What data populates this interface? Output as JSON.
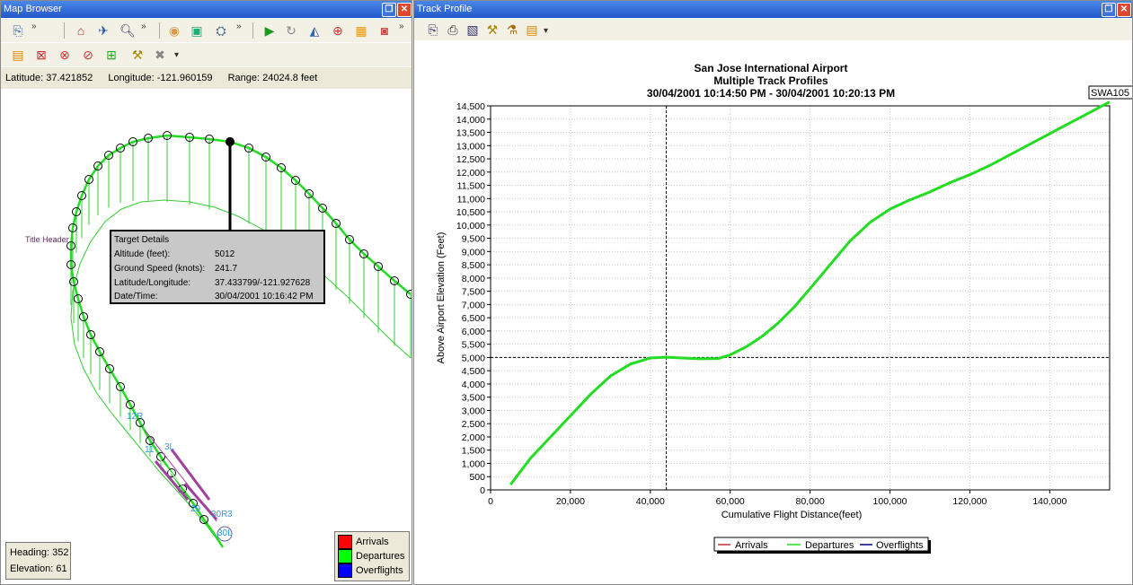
{
  "left_window": {
    "title": "Map Browser",
    "coords": {
      "latitude": "Latitude: 37.421852",
      "longitude": "Longitude: -121.960159",
      "range": "Range: 24024.8 feet"
    },
    "tooltip": {
      "heading": "Target Details",
      "rows": [
        {
          "label": "Altitude (feet):",
          "value": "5012"
        },
        {
          "label": "Ground Speed (knots):",
          "value": "241.7"
        },
        {
          "label": "Latitude/Longitude:",
          "value": "37.433799/-121.927628"
        },
        {
          "label": "Date/Time:",
          "value": "30/04/2001 10:16:42 PM"
        }
      ]
    },
    "map_labels": {
      "title_header": "Title Header",
      "runway_12r": "12R",
      "runway_11": "11",
      "runway_3l": "3L",
      "runway_29": "29",
      "runway_30r": "30R",
      "runway_3": "3",
      "runway_30l": "30L"
    },
    "status": {
      "heading": "Heading: 352",
      "elevation": "Elevation: 61"
    },
    "legend": [
      {
        "label": "Arrivals",
        "color": "#ff0000"
      },
      {
        "label": "Departures",
        "color": "#00ff00"
      },
      {
        "label": "Overflights",
        "color": "#0000ff"
      }
    ]
  },
  "right_window": {
    "title": "Track Profile",
    "track_tag": "SWA105"
  },
  "colors": {
    "track": "#22dd22",
    "curtain": "#33cc33",
    "title_bar": "#2458c9"
  },
  "chart_data": {
    "type": "line",
    "title": "San Jose International Airport",
    "subtitle": "Multiple Track Profiles",
    "time_range": "30/04/2001 10:14:50 PM - 30/04/2001 10:20:13 PM",
    "xlabel": "Cumulative Flight Distance(feet)",
    "ylabel": "Above Airport Elevation (Feet)",
    "xlim": [
      0,
      155000
    ],
    "ylim": [
      0,
      14500
    ],
    "x_ticks": [
      0,
      20000,
      40000,
      60000,
      80000,
      100000,
      120000,
      140000
    ],
    "x_tick_labels": [
      "0",
      "20,000",
      "40,000",
      "60,000",
      "80,000",
      "100,000",
      "120,000",
      "140,000"
    ],
    "y_ticks": [
      0,
      500,
      1000,
      1500,
      2000,
      2500,
      3000,
      3500,
      4000,
      4500,
      5000,
      5500,
      6000,
      6500,
      7000,
      7500,
      8000,
      8500,
      9000,
      9500,
      10000,
      10500,
      11000,
      11500,
      12000,
      12500,
      13000,
      13500,
      14000,
      14500
    ],
    "y_tick_labels": [
      "0",
      "500",
      "1,000",
      "1,500",
      "2,000",
      "2,500",
      "3,000",
      "3,500",
      "4,000",
      "4,500",
      "5,000",
      "5,500",
      "6,000",
      "6,500",
      "7,000",
      "7,500",
      "8,000",
      "8,500",
      "9,000",
      "9,500",
      "10,000",
      "10,500",
      "11,000",
      "11,500",
      "12,000",
      "12,500",
      "13,000",
      "13,500",
      "14,000",
      "14,500"
    ],
    "grid": true,
    "crosshair": {
      "x": 44000,
      "y": 5000
    },
    "legend": [
      "Arrivals",
      "Departures",
      "Overflights"
    ],
    "legend_position": "bottom",
    "series": [
      {
        "name": "Departures",
        "color": "#22dd22",
        "x": [
          5000,
          10000,
          15000,
          20000,
          25000,
          30000,
          35000,
          40000,
          44000,
          48000,
          52000,
          57000,
          60000,
          64000,
          68000,
          72000,
          76000,
          80000,
          85000,
          90000,
          95000,
          100000,
          105000,
          110000,
          115000,
          120000,
          125000,
          130000,
          135000,
          140000,
          145000,
          150000,
          155000
        ],
        "y": [
          200,
          1200,
          2000,
          2800,
          3600,
          4300,
          4750,
          4980,
          5010,
          4980,
          4950,
          4960,
          5100,
          5400,
          5800,
          6300,
          6900,
          7600,
          8500,
          9400,
          10100,
          10600,
          10950,
          11250,
          11600,
          11900,
          12250,
          12650,
          13050,
          13450,
          13850,
          14250,
          14650
        ]
      }
    ]
  }
}
